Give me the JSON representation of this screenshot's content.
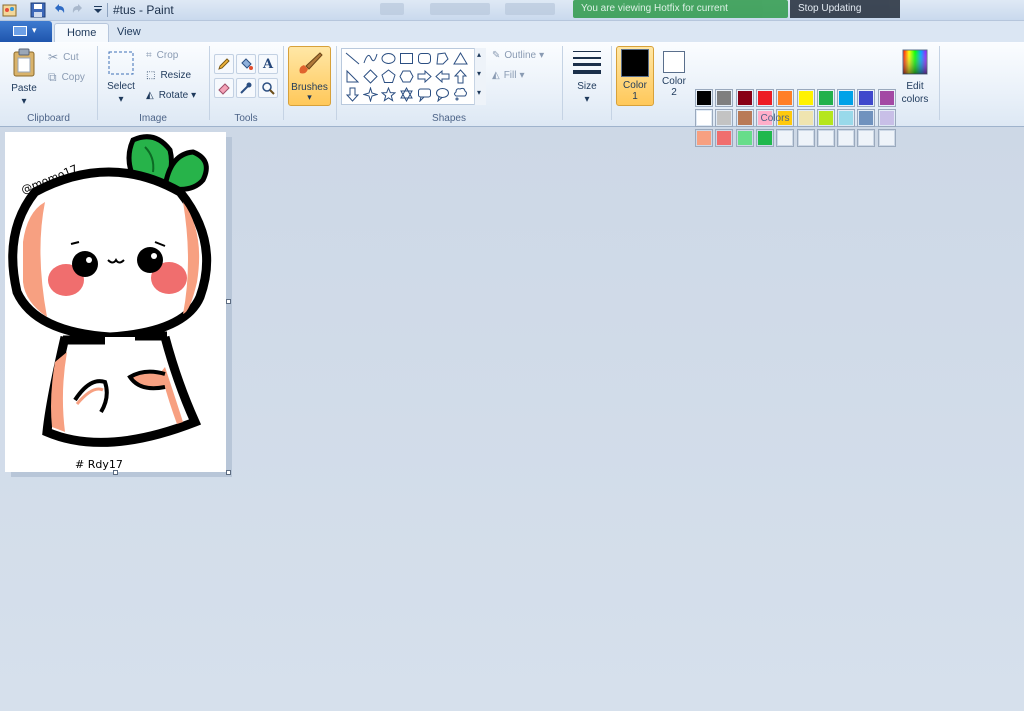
{
  "window": {
    "title": "#tus - Paint",
    "notice_green": "You are viewing Hotfix for current",
    "notice_dark": "Stop Updating"
  },
  "tabs": [
    {
      "label": "Home",
      "active": true
    },
    {
      "label": "View",
      "active": false
    }
  ],
  "clipboard": {
    "paste": "Paste",
    "cut": "Cut",
    "copy": "Copy",
    "group": "Clipboard"
  },
  "image": {
    "select": "Select",
    "crop": "Crop",
    "resize": "Resize",
    "rotate": "Rotate",
    "group": "Image"
  },
  "tools": {
    "group": "Tools"
  },
  "brushes": {
    "label": "Brushes"
  },
  "shapes": {
    "outline": "Outline",
    "fill": "Fill",
    "group": "Shapes"
  },
  "size": {
    "label": "Size"
  },
  "colors": {
    "color1": "Color",
    "color1_num": "1",
    "color2": "Color",
    "color2_num": "2",
    "edit": "Edit",
    "edit2": "colors",
    "group": "Colors",
    "color1_value": "#000000",
    "color2_value": "#ffffff",
    "palette_row1": [
      "#000000",
      "#7f7f7f",
      "#880015",
      "#ed1c24",
      "#ff7f27",
      "#fff200",
      "#22b14c",
      "#00a2e8",
      "#3f48cc",
      "#a349a4"
    ],
    "palette_row2": [
      "#ffffff",
      "#c3c3c3",
      "#b97a57",
      "#ffaec9",
      "#ffc90e",
      "#efe4b0",
      "#b5e61d",
      "#99d9ea",
      "#7092be",
      "#c8bfe7"
    ],
    "palette_row3": [
      "#f7a081",
      "#f06e6e",
      "#67dd8a",
      "#1fb84c",
      "",
      "",
      "",
      "",
      "",
      ""
    ]
  },
  "drawing": {
    "signature_top": "@momo17",
    "signature_bottom": "# Rdy17"
  }
}
